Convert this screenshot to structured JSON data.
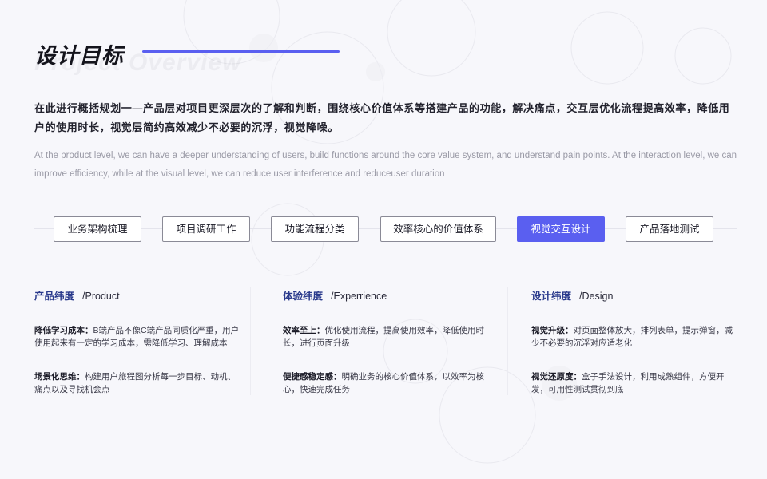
{
  "header": {
    "title": "设计目标",
    "title_shadow": "Project Overview",
    "accent_color": "#5a5ff0"
  },
  "intro": {
    "cn": "在此进行概括规划一—产品层对项目更深层次的了解和判断，围绕核心价值体系等搭建产品的功能，解决痛点，交互层优化流程提高效率，降低用户的使用时长，视觉层简约高效减少不必要的沉浮，视觉降噪。",
    "en": "At the product level, we can have a deeper understanding of users, build functions around the core value system, and understand pain points. At the interaction level, we can improve efficiency, while at the visual level, we can reduce user interference and reduceuser duration"
  },
  "tabs": [
    {
      "label": "业务架构梳理",
      "active": false
    },
    {
      "label": "项目调研工作",
      "active": false
    },
    {
      "label": "功能流程分类",
      "active": false
    },
    {
      "label": "效率核心的价值体系",
      "active": false
    },
    {
      "label": "视觉交互设计",
      "active": true
    },
    {
      "label": "产品落地测试",
      "active": false
    }
  ],
  "columns": [
    {
      "title_cn": "产品纬度",
      "title_en": "/Product",
      "items": [
        {
          "label": "降低学习成本：",
          "text": "B端产品不像C端产品同质化严重，用户使用起来有一定的学习成本，需降低学习、理解成本"
        },
        {
          "label": "场景化思维：",
          "text": "构建用户旅程图分析每一步目标、动机、痛点以及寻找机会点"
        }
      ]
    },
    {
      "title_cn": "体验纬度",
      "title_en": "/Experrience",
      "items": [
        {
          "label": "效率至上：",
          "text": "优化使用流程，提高使用效率，降低使用时长，进行页面升级"
        },
        {
          "label": "便捷感稳定感：",
          "text": "明确业务的核心价值体系，以效率为核心，快速完成任务"
        }
      ]
    },
    {
      "title_cn": "设计纬度",
      "title_en": "/Design",
      "items": [
        {
          "label": "视觉升级：",
          "text": "对页面整体放大，排列表单，提示弹窗，减少不必要的沉浮对应适老化"
        },
        {
          "label": "视觉还原度：",
          "text": "盒子手法设计，利用成熟组件，方便开发，可用性测试贯彻到底"
        }
      ]
    }
  ]
}
